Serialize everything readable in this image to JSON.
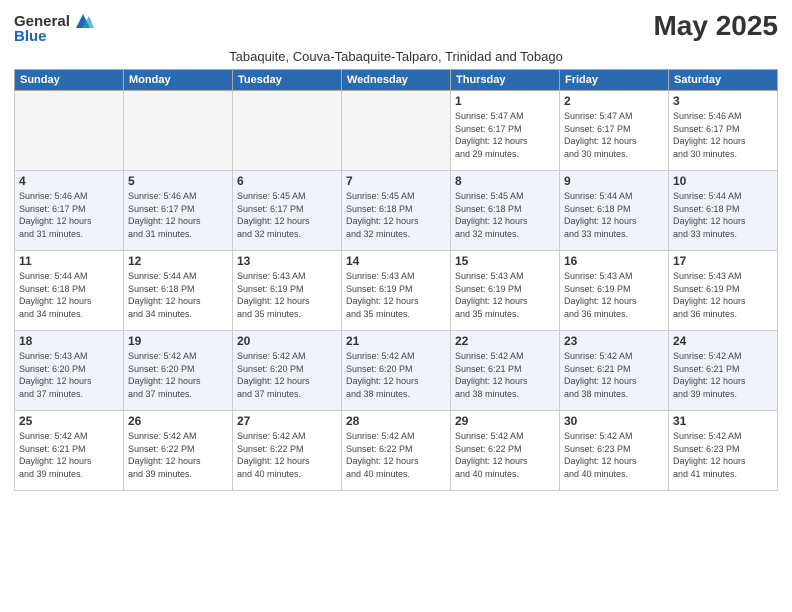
{
  "app": {
    "logo_general": "General",
    "logo_blue": "Blue",
    "title": "May 2025",
    "subtitle": "Tabaquite, Couva-Tabaquite-Talparo, Trinidad and Tobago"
  },
  "calendar": {
    "headers": [
      "Sunday",
      "Monday",
      "Tuesday",
      "Wednesday",
      "Thursday",
      "Friday",
      "Saturday"
    ],
    "weeks": [
      [
        {
          "day": "",
          "info": ""
        },
        {
          "day": "",
          "info": ""
        },
        {
          "day": "",
          "info": ""
        },
        {
          "day": "",
          "info": ""
        },
        {
          "day": "1",
          "info": "Sunrise: 5:47 AM\nSunset: 6:17 PM\nDaylight: 12 hours\nand 29 minutes."
        },
        {
          "day": "2",
          "info": "Sunrise: 5:47 AM\nSunset: 6:17 PM\nDaylight: 12 hours\nand 30 minutes."
        },
        {
          "day": "3",
          "info": "Sunrise: 5:46 AM\nSunset: 6:17 PM\nDaylight: 12 hours\nand 30 minutes."
        }
      ],
      [
        {
          "day": "4",
          "info": "Sunrise: 5:46 AM\nSunset: 6:17 PM\nDaylight: 12 hours\nand 31 minutes."
        },
        {
          "day": "5",
          "info": "Sunrise: 5:46 AM\nSunset: 6:17 PM\nDaylight: 12 hours\nand 31 minutes."
        },
        {
          "day": "6",
          "info": "Sunrise: 5:45 AM\nSunset: 6:17 PM\nDaylight: 12 hours\nand 32 minutes."
        },
        {
          "day": "7",
          "info": "Sunrise: 5:45 AM\nSunset: 6:18 PM\nDaylight: 12 hours\nand 32 minutes."
        },
        {
          "day": "8",
          "info": "Sunrise: 5:45 AM\nSunset: 6:18 PM\nDaylight: 12 hours\nand 32 minutes."
        },
        {
          "day": "9",
          "info": "Sunrise: 5:44 AM\nSunset: 6:18 PM\nDaylight: 12 hours\nand 33 minutes."
        },
        {
          "day": "10",
          "info": "Sunrise: 5:44 AM\nSunset: 6:18 PM\nDaylight: 12 hours\nand 33 minutes."
        }
      ],
      [
        {
          "day": "11",
          "info": "Sunrise: 5:44 AM\nSunset: 6:18 PM\nDaylight: 12 hours\nand 34 minutes."
        },
        {
          "day": "12",
          "info": "Sunrise: 5:44 AM\nSunset: 6:18 PM\nDaylight: 12 hours\nand 34 minutes."
        },
        {
          "day": "13",
          "info": "Sunrise: 5:43 AM\nSunset: 6:19 PM\nDaylight: 12 hours\nand 35 minutes."
        },
        {
          "day": "14",
          "info": "Sunrise: 5:43 AM\nSunset: 6:19 PM\nDaylight: 12 hours\nand 35 minutes."
        },
        {
          "day": "15",
          "info": "Sunrise: 5:43 AM\nSunset: 6:19 PM\nDaylight: 12 hours\nand 35 minutes."
        },
        {
          "day": "16",
          "info": "Sunrise: 5:43 AM\nSunset: 6:19 PM\nDaylight: 12 hours\nand 36 minutes."
        },
        {
          "day": "17",
          "info": "Sunrise: 5:43 AM\nSunset: 6:19 PM\nDaylight: 12 hours\nand 36 minutes."
        }
      ],
      [
        {
          "day": "18",
          "info": "Sunrise: 5:43 AM\nSunset: 6:20 PM\nDaylight: 12 hours\nand 37 minutes."
        },
        {
          "day": "19",
          "info": "Sunrise: 5:42 AM\nSunset: 6:20 PM\nDaylight: 12 hours\nand 37 minutes."
        },
        {
          "day": "20",
          "info": "Sunrise: 5:42 AM\nSunset: 6:20 PM\nDaylight: 12 hours\nand 37 minutes."
        },
        {
          "day": "21",
          "info": "Sunrise: 5:42 AM\nSunset: 6:20 PM\nDaylight: 12 hours\nand 38 minutes."
        },
        {
          "day": "22",
          "info": "Sunrise: 5:42 AM\nSunset: 6:21 PM\nDaylight: 12 hours\nand 38 minutes."
        },
        {
          "day": "23",
          "info": "Sunrise: 5:42 AM\nSunset: 6:21 PM\nDaylight: 12 hours\nand 38 minutes."
        },
        {
          "day": "24",
          "info": "Sunrise: 5:42 AM\nSunset: 6:21 PM\nDaylight: 12 hours\nand 39 minutes."
        }
      ],
      [
        {
          "day": "25",
          "info": "Sunrise: 5:42 AM\nSunset: 6:21 PM\nDaylight: 12 hours\nand 39 minutes."
        },
        {
          "day": "26",
          "info": "Sunrise: 5:42 AM\nSunset: 6:22 PM\nDaylight: 12 hours\nand 39 minutes."
        },
        {
          "day": "27",
          "info": "Sunrise: 5:42 AM\nSunset: 6:22 PM\nDaylight: 12 hours\nand 40 minutes."
        },
        {
          "day": "28",
          "info": "Sunrise: 5:42 AM\nSunset: 6:22 PM\nDaylight: 12 hours\nand 40 minutes."
        },
        {
          "day": "29",
          "info": "Sunrise: 5:42 AM\nSunset: 6:22 PM\nDaylight: 12 hours\nand 40 minutes."
        },
        {
          "day": "30",
          "info": "Sunrise: 5:42 AM\nSunset: 6:23 PM\nDaylight: 12 hours\nand 40 minutes."
        },
        {
          "day": "31",
          "info": "Sunrise: 5:42 AM\nSunset: 6:23 PM\nDaylight: 12 hours\nand 41 minutes."
        }
      ]
    ]
  }
}
